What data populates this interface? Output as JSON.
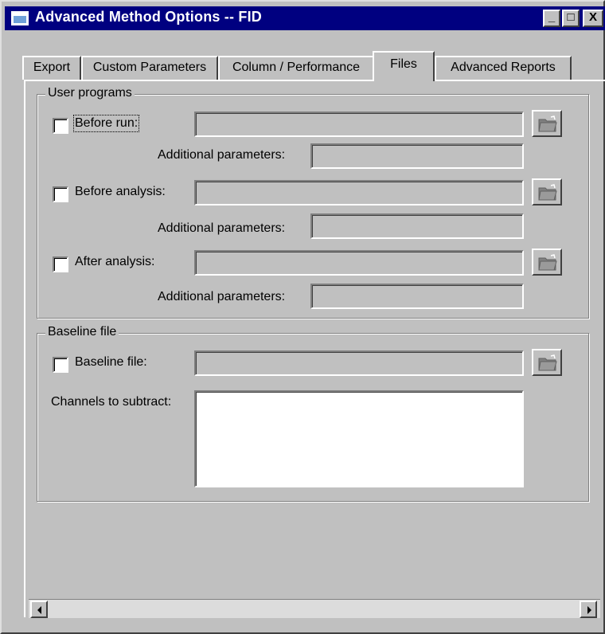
{
  "window": {
    "title": "Advanced Method Options -- FID",
    "minimize_glyph": "_",
    "maximize_glyph": "□",
    "close_glyph": "X"
  },
  "tabs": [
    {
      "label": "Export",
      "active": false
    },
    {
      "label": "Custom Parameters",
      "active": false
    },
    {
      "label": "Column / Performance",
      "active": false
    },
    {
      "label": "Files",
      "active": true
    },
    {
      "label": "Advanced Reports",
      "active": false
    }
  ],
  "user_programs": {
    "legend": "User programs",
    "additional_label": "Additional parameters:",
    "items": [
      {
        "label": "Before run:",
        "checked": false,
        "path": "",
        "params": ""
      },
      {
        "label": "Before analysis:",
        "checked": false,
        "path": "",
        "params": ""
      },
      {
        "label": "After analysis:",
        "checked": false,
        "path": "",
        "params": ""
      }
    ]
  },
  "baseline": {
    "legend": "Baseline file",
    "checkbox_label": "Baseline file:",
    "checked": false,
    "path": "",
    "channels_label": "Channels to subtract:",
    "channels_value": ""
  },
  "icons": {
    "browse": "folder-open-icon",
    "scroll_left": "arrow-left-icon",
    "scroll_right": "arrow-right-icon"
  },
  "colors": {
    "titlebar": "#000080",
    "face": "#c0c0c0"
  }
}
